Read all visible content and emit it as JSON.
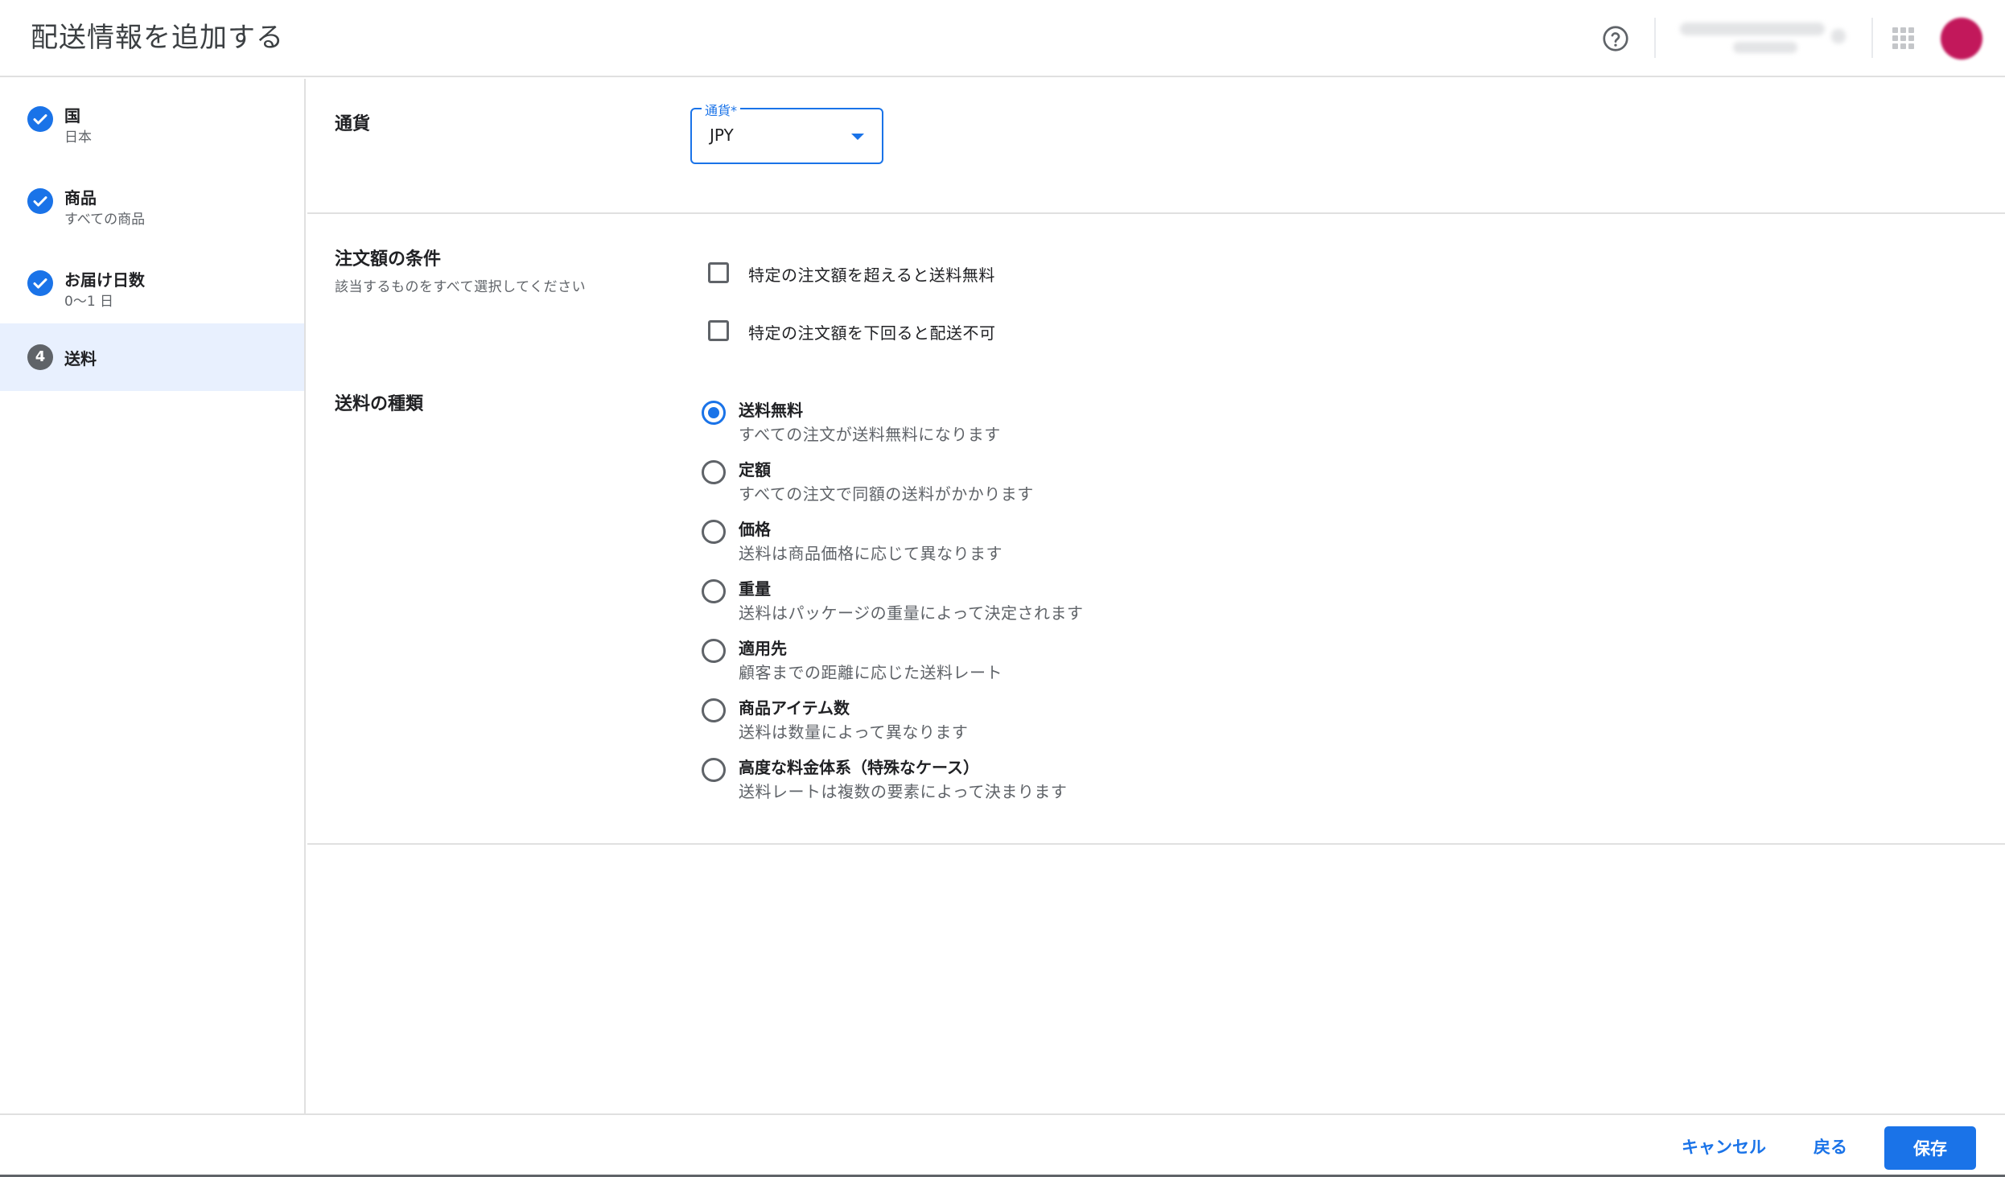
{
  "header": {
    "title": "配送情報を追加する",
    "help_icon": "help-circle-icon",
    "apps_icon": "apps-grid-icon"
  },
  "sidebar": {
    "steps": [
      {
        "title": "国",
        "subtitle": "日本",
        "status": "done"
      },
      {
        "title": "商品",
        "subtitle": "すべての商品",
        "status": "done"
      },
      {
        "title": "お届け日数",
        "subtitle": "0〜1 日",
        "status": "done"
      },
      {
        "number": "4",
        "title": "送料",
        "status": "active"
      }
    ]
  },
  "currency": {
    "section_label": "通貨",
    "field_label": "通貨*",
    "value": "JPY"
  },
  "order_conditions": {
    "section_label": "注文額の条件",
    "help_text": "該当するものをすべて選択してください",
    "options": [
      {
        "label": "特定の注文額を超えると送料無料",
        "checked": false
      },
      {
        "label": "特定の注文額を下回ると配送不可",
        "checked": false
      }
    ]
  },
  "shipping_type": {
    "section_label": "送料の種類",
    "options": [
      {
        "title": "送料無料",
        "description": "すべての注文が送料無料になります",
        "selected": true
      },
      {
        "title": "定額",
        "description": "すべての注文で同額の送料がかかります",
        "selected": false
      },
      {
        "title": "価格",
        "description": "送料は商品価格に応じて異なります",
        "selected": false
      },
      {
        "title": "重量",
        "description": "送料はパッケージの重量によって決定されます",
        "selected": false
      },
      {
        "title": "適用先",
        "description": "顧客までの距離に応じた送料レート",
        "selected": false
      },
      {
        "title": "商品アイテム数",
        "description": "送料は数量によって異なります",
        "selected": false
      },
      {
        "title": "高度な料金体系（特殊なケース）",
        "description": "送料レートは複数の要素によって決まります",
        "selected": false
      }
    ]
  },
  "footer": {
    "cancel_label": "キャンセル",
    "back_label": "戻る",
    "save_label": "保存"
  },
  "colors": {
    "accent": "#1a73e8",
    "active_step_bg": "#e8f0fe",
    "avatar": "#c2185b"
  }
}
